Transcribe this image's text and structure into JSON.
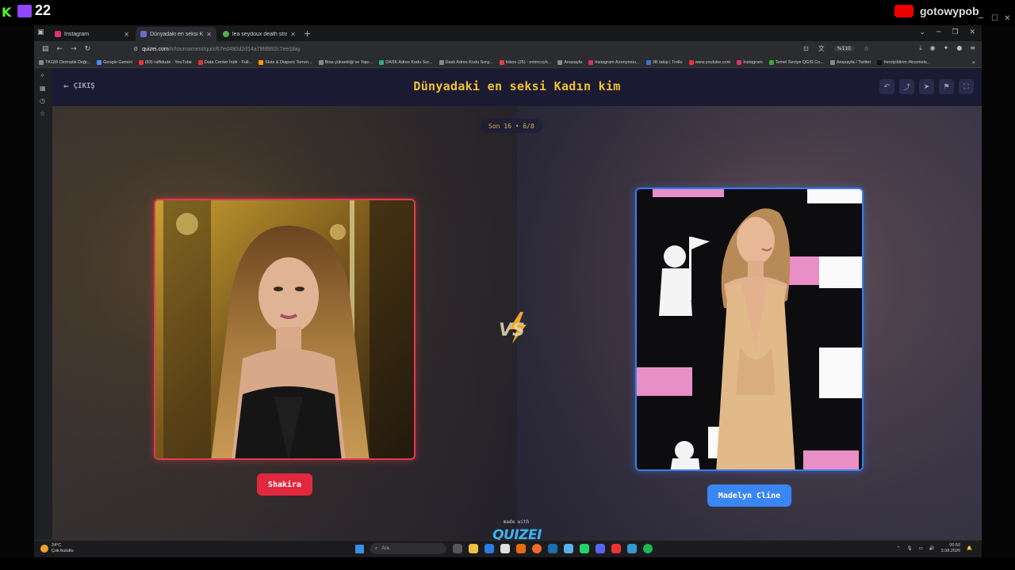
{
  "stream": {
    "viewer_count": "22",
    "channel_name": "gotowypob"
  },
  "browser": {
    "tabs": [
      {
        "title": "Instagram",
        "active": false,
        "color": "#e1306c"
      },
      {
        "title": "Dünyadaki en seksi Kadın kim",
        "active": true,
        "color": "#6b6bd6"
      },
      {
        "title": "lea seydoux death stranding fe",
        "active": false,
        "color": "#4caf50"
      }
    ],
    "url_host": "quizei.com",
    "url_path": "/tr/tournament/quiz/67ed490d2d14a79fd992c7ee/play",
    "zoom": "%110",
    "bookmarks": [
      "TKGM Otomatik Doğr...",
      "Google Gemini",
      "(83) raffidude - YouTube",
      "Data Center İndir - Full...",
      "Slots & Diapers Torren...",
      "Bina yüksekliği ve Yapı...",
      "DASK Adres Kodu Sor...",
      "Dask Adres Kodu Sorg...",
      "Inbox (25) - emincxyh...",
      "Anasayfa",
      "Instagram Anonymou...",
      "3B takip | Trello",
      "www.youtube.com",
      "Instagram",
      "Temel Seviye QGIS Co...",
      "Anasayfa / Twitter",
      "#erolyildirim #kozmets..."
    ]
  },
  "quiz": {
    "back_label": "ÇIKIŞ",
    "title": "Dünyadaki en seksi Kadın kim",
    "round": "Son 16 • 6/8",
    "left_name": "Shakira",
    "right_name": "Madelyn Cline",
    "vs_text": "VS",
    "made_with": "made with",
    "brand": "QUIZEI"
  },
  "taskbar": {
    "temperature": "24°C",
    "weather": "Çok bulutlu",
    "search_placeholder": "Ara",
    "time": "00:50",
    "date": "3.08.2026"
  },
  "colors": {
    "accent_gold": "#f2c233",
    "left_red": "#e2283f",
    "right_blue": "#3a86f5",
    "page_bg": "#1b1a33"
  }
}
